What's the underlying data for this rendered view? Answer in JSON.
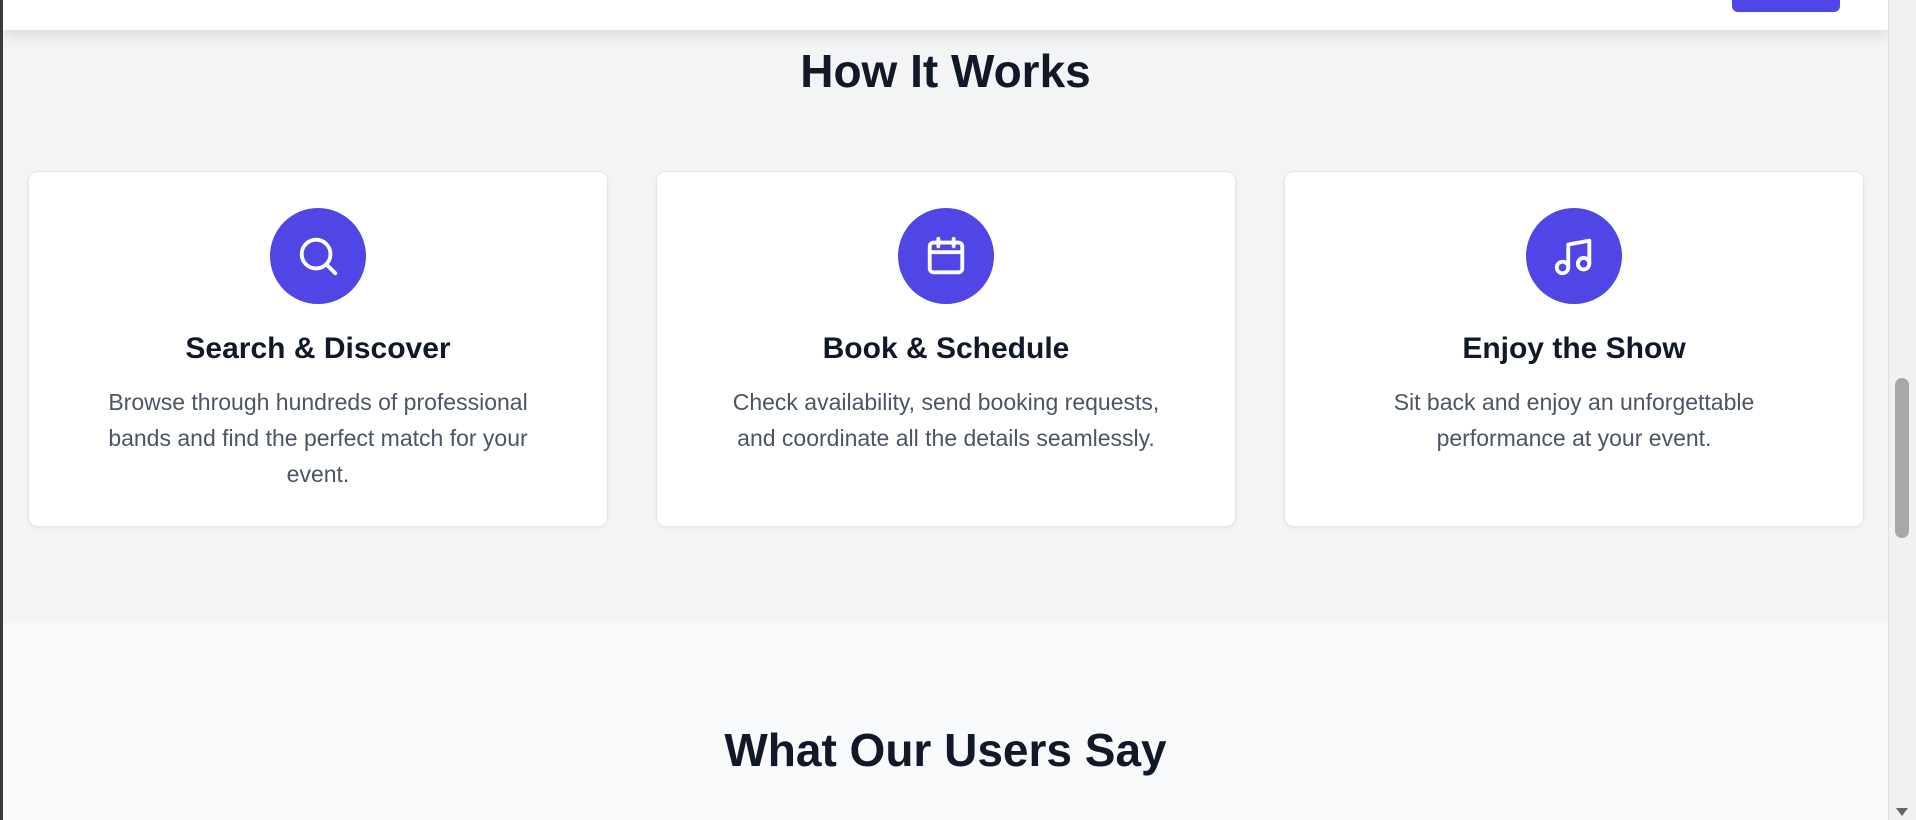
{
  "colors": {
    "accent": "#4f46e5",
    "heading": "#111827",
    "body_text": "#4b5563",
    "section_bg": "#f3f4f6",
    "card_bg": "#ffffff"
  },
  "how_it_works": {
    "title": "How It Works",
    "steps": [
      {
        "icon": "search-icon",
        "title": "Search & Discover",
        "description": "Browse through hundreds of professional bands and find the perfect match for your event."
      },
      {
        "icon": "calendar-icon",
        "title": "Book & Schedule",
        "description": "Check availability, send booking requests, and coordinate all the details seamlessly."
      },
      {
        "icon": "music-note-icon",
        "title": "Enjoy the Show",
        "description": "Sit back and enjoy an unforgettable performance at your event."
      }
    ]
  },
  "testimonials": {
    "title": "What Our Users Say"
  }
}
